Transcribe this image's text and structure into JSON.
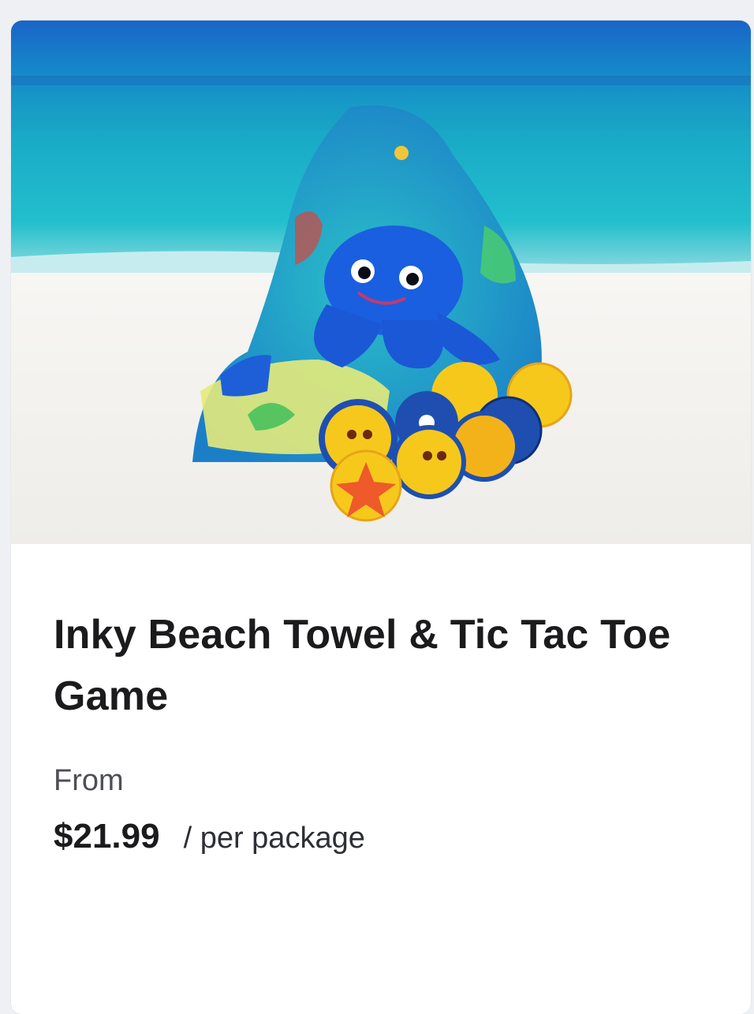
{
  "product": {
    "title": "Inky Beach Towel & Tic Tac Toe Game",
    "from_label": "From",
    "price": "$21.99",
    "unit": "/ per package",
    "image": "inky-octopus-towel-and-game-tokens-on-beach"
  },
  "colors": {
    "ocean_dark": "#1f6fc4",
    "ocean_teal": "#1fb3c4",
    "sand": "#f3f2ef",
    "octopus_blue": "#1a5fe0",
    "token_yellow": "#f6c81c",
    "title_text": "#1b1b1d",
    "muted_text": "#4d4f55"
  }
}
